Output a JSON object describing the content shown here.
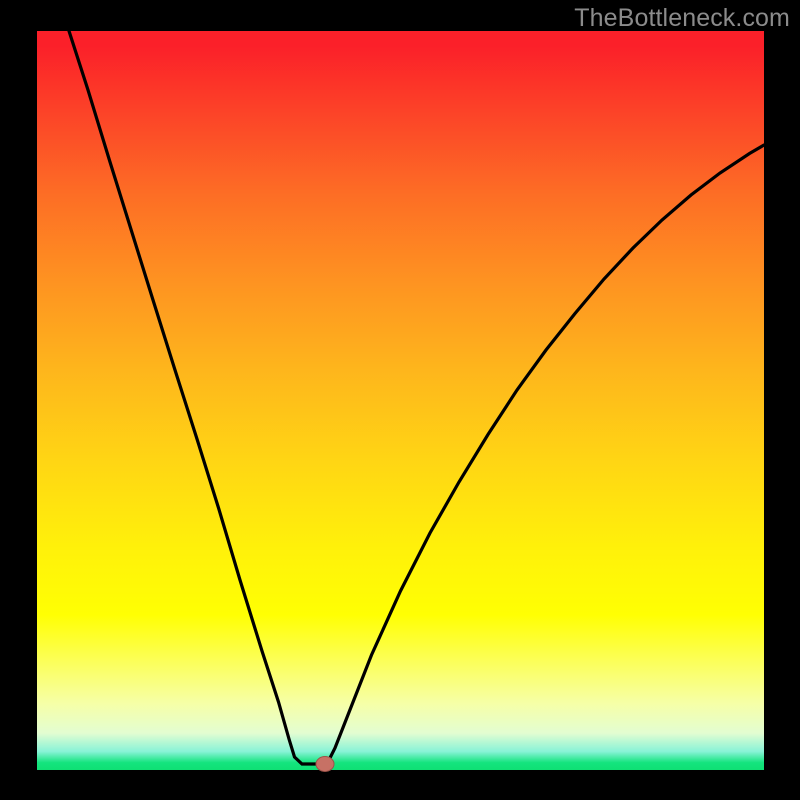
{
  "watermark": "TheBottleneck.com",
  "colors": {
    "background": "#000000",
    "curve": "#000000",
    "marker_fill": "#c77165",
    "marker_stroke": "#9c5249"
  },
  "chart_data": {
    "type": "line",
    "title": "",
    "xlabel": "",
    "ylabel": "",
    "xlim": [
      0,
      100
    ],
    "ylim": [
      0,
      100
    ],
    "note": "Bottleneck V-curve. Axes unlabeled; values estimated from pixel positions within the 727×739 plot area. x runs left→right, y runs bottom→top (0 = bottom / green band, 100 = top / red).",
    "series": [
      {
        "name": "bottleneck-curve",
        "points_xy": [
          [
            4.4,
            100.0
          ],
          [
            7.0,
            92.0
          ],
          [
            10.0,
            82.4
          ],
          [
            13.0,
            73.0
          ],
          [
            16.0,
            63.6
          ],
          [
            19.0,
            54.2
          ],
          [
            22.0,
            44.8
          ],
          [
            25.0,
            35.4
          ],
          [
            28.0,
            25.8
          ],
          [
            31.0,
            16.2
          ],
          [
            33.2,
            9.3
          ],
          [
            34.7,
            4.3
          ],
          [
            35.4,
            1.8
          ],
          [
            36.5,
            0.8
          ],
          [
            39.0,
            0.8
          ],
          [
            40.1,
            1.2
          ],
          [
            41.0,
            3.0
          ],
          [
            43.0,
            8.0
          ],
          [
            46.0,
            15.5
          ],
          [
            50.0,
            24.2
          ],
          [
            54.0,
            32.0
          ],
          [
            58.0,
            39.0
          ],
          [
            62.0,
            45.4
          ],
          [
            66.0,
            51.4
          ],
          [
            70.0,
            56.8
          ],
          [
            74.0,
            61.8
          ],
          [
            78.0,
            66.4
          ],
          [
            82.0,
            70.6
          ],
          [
            86.0,
            74.4
          ],
          [
            90.0,
            77.8
          ],
          [
            94.0,
            80.8
          ],
          [
            98.0,
            83.4
          ],
          [
            100.0,
            84.6
          ]
        ]
      }
    ],
    "marker": {
      "x": 39.6,
      "y": 0.8
    }
  }
}
